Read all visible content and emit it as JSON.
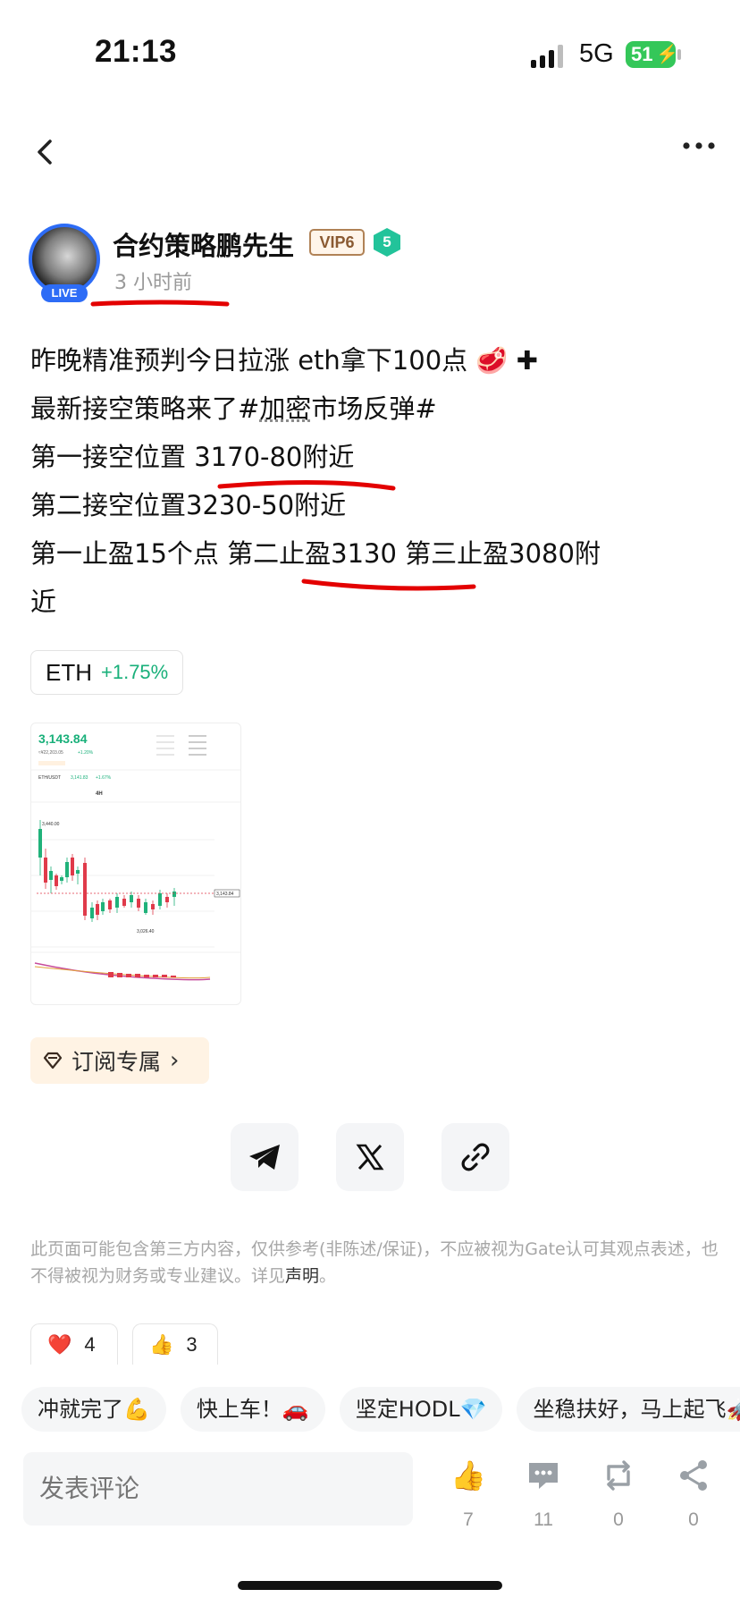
{
  "status_bar": {
    "time": "21:13",
    "network": "5G",
    "battery": "51"
  },
  "author": {
    "name": "合约策略鹏先生",
    "vip": "VIP6",
    "level": "5",
    "live_label": "LIVE",
    "time_ago": "3 小时前"
  },
  "post": {
    "line1": "昨晚精准预判今日拉涨 eth拿下100点",
    "line2_prefix": " 最新接空策略来了",
    "hashtag_a": "#",
    "hashtag_b": "加密",
    "hashtag_c": "市场反弹#",
    "line3": "第一接空位置 3170-80附近",
    "line4": "第二接空位置3230-50附近",
    "line5": "第一止盈15个点 第二止盈3130 第三止盈3080附",
    "line6": "近"
  },
  "ticker": {
    "symbol": "ETH",
    "change": "+1.75%"
  },
  "chart_thumb": {
    "price": "3,143.84",
    "sub_price": "≈¥22,203.05",
    "sub_change": "+1.20%",
    "pair": "ETH/USDT",
    "pair_price": "3,141.83",
    "pair_change": "+1.67%",
    "interval": "4H",
    "high_label": "3,440.00",
    "low_label": "3,026.40",
    "last_label": "3,143.84"
  },
  "subscribe": {
    "label": "订阅专属"
  },
  "disclaimer": {
    "text": "此页面可能包含第三方内容，仅供参考(非陈述/保证)，不应被视为Gate认可其观点表述，也不得被视为财务或专业建议。详见",
    "link": "声明",
    "end": "。"
  },
  "reactions": [
    {
      "emoji": "❤️",
      "count": "4"
    },
    {
      "emoji": "👍",
      "count": "3"
    }
  ],
  "quick_replies": [
    "冲就完了💪",
    "快上车！🚗",
    "坚定HODL💎",
    "坐稳扶好，马上起飞🚀"
  ],
  "bottom": {
    "comment_placeholder": "发表评论",
    "likes": "7",
    "comments": "11",
    "reposts": "0",
    "shares": "0"
  },
  "colors": {
    "accent_green": "#19b07a",
    "live_blue": "#2d6cf6",
    "annotation_red": "#e30000"
  }
}
